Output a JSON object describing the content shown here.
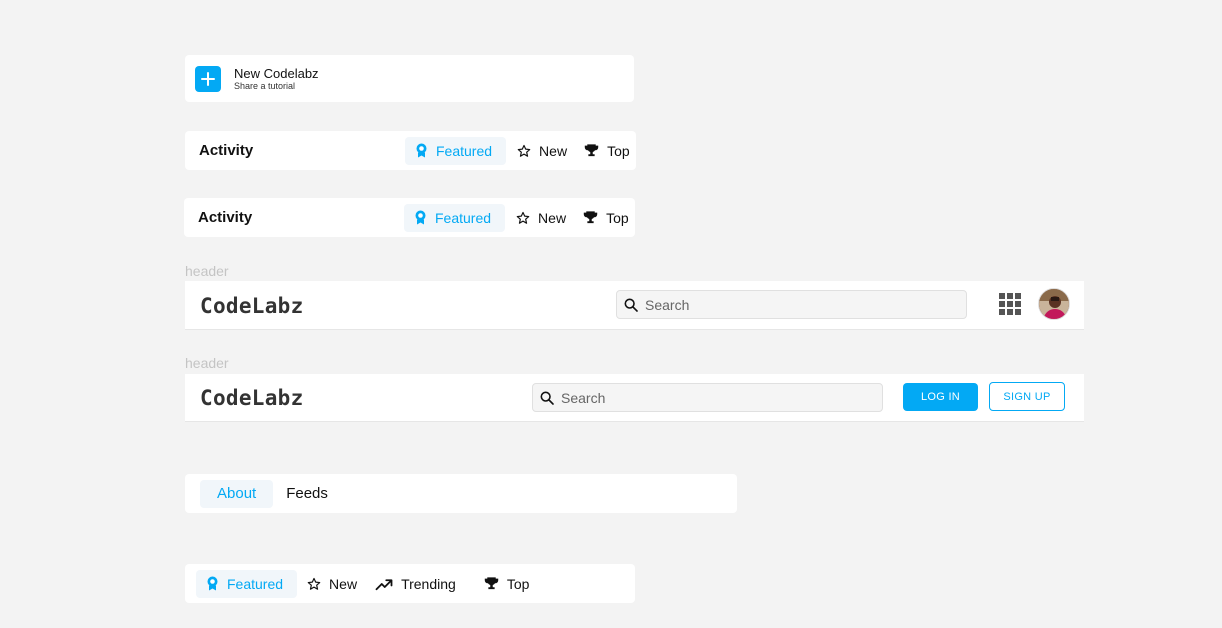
{
  "new_codelabz": {
    "title": "New Codelabz",
    "subtitle": "Share a tutorial",
    "icon": "plus-icon"
  },
  "activity_bars": [
    {
      "title": "Activity",
      "tabs": [
        {
          "label": "Featured",
          "icon": "featured-badge-icon",
          "active": true
        },
        {
          "label": "New",
          "icon": "star-outline-icon",
          "active": false
        },
        {
          "label": "Top",
          "icon": "trophy-icon",
          "active": false
        }
      ]
    },
    {
      "title": "Activity",
      "tabs": [
        {
          "label": "Featured",
          "icon": "featured-badge-icon",
          "active": true
        },
        {
          "label": "New",
          "icon": "star-outline-icon",
          "active": false
        },
        {
          "label": "Top",
          "icon": "trophy-icon",
          "active": false
        }
      ]
    }
  ],
  "header_logged_in": {
    "section_label": "header",
    "logo": "CodeLabz",
    "search_placeholder": "Search",
    "apps_icon": "apps-grid-icon",
    "avatar_icon": "user-avatar"
  },
  "header_logged_out": {
    "section_label": "header",
    "logo": "CodeLabz",
    "search_placeholder": "Search",
    "login_label": "LOG IN",
    "signup_label": "SIGN UP"
  },
  "profile_tabs": [
    {
      "label": "About",
      "active": true
    },
    {
      "label": "Feeds",
      "active": false
    }
  ],
  "feed_filters": [
    {
      "label": "Featured",
      "icon": "featured-badge-icon",
      "active": true
    },
    {
      "label": "New",
      "icon": "star-outline-icon",
      "active": false
    },
    {
      "label": "Trending",
      "icon": "trending-up-icon",
      "active": false
    },
    {
      "label": "Top",
      "icon": "trophy-icon",
      "active": false
    }
  ],
  "colors": {
    "accent": "#03a9f4",
    "background": "#f3f3f3",
    "card": "#ffffff"
  }
}
